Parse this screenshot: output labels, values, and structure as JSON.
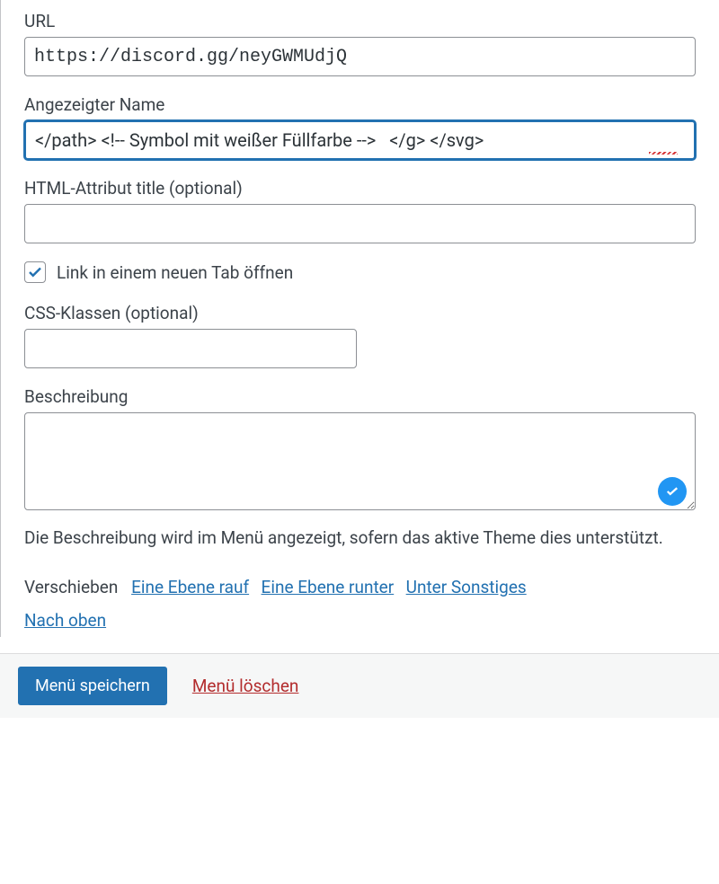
{
  "fields": {
    "url": {
      "label": "URL",
      "value": "https://discord.gg/neyGWMUdjQ"
    },
    "display_name": {
      "label": "Angezeigter Name",
      "value": "</path> <!-- Symbol mit weißer Füllfarbe -->   </g> </svg>"
    },
    "title_attr": {
      "label": "HTML-Attribut title (optional)",
      "value": ""
    },
    "new_tab": {
      "label": "Link in einem neuen Tab öffnen",
      "checked": true
    },
    "css_classes": {
      "label": "CSS-Klassen (optional)",
      "value": ""
    },
    "description": {
      "label": "Beschreibung",
      "value": "",
      "help": "Die Beschreibung wird im Menü angezeigt, sofern das aktive Theme dies unterstützt."
    }
  },
  "move": {
    "label": "Verschieben",
    "links": {
      "up": "Eine Ebene rauf",
      "down": "Eine Ebene runter",
      "under": "Unter Sonstiges",
      "top": "Nach oben"
    }
  },
  "footer": {
    "save": "Menü speichern",
    "delete": "Menü löschen"
  }
}
